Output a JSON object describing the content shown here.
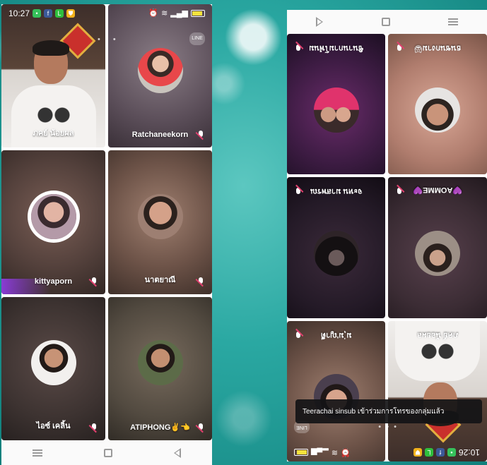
{
  "left_phone": {
    "status_bar": {
      "time": "10:27"
    },
    "tiles": [
      {
        "name": "ภคย์ น้อยผล"
      },
      {
        "name": "Ratchaneekorn"
      },
      {
        "name": "kittyaporn"
      },
      {
        "name": "นาตยาณี"
      },
      {
        "name": "ไอซ์ เคลิ้น"
      },
      {
        "name": "ATIPHONG✌️👈"
      }
    ],
    "line_badge": "LINE",
    "more_dots": "• • •"
  },
  "right_phone": {
    "status_bar": {
      "time": "10:26"
    },
    "tiles": [
      {
        "name": "ภคย์ น้อยผล"
      },
      {
        "name": "ม ุ่ม'ญาตี"
      },
      {
        "name": "💜AOMME💜"
      },
      {
        "name": "จะหน มาสพรณ"
      },
      {
        "name": "ธนชนกงาม😸"
      },
      {
        "name": "ชินานกามโฟ่นม"
      }
    ],
    "line_badge": "LINE",
    "more_dots": "• • •",
    "toast": "Teerachai sinsub เข้าร่วมการโทรของกลุ่มแล้ว"
  },
  "colors": {
    "background_teal": "#2aa8a2",
    "toast_bg": "#141416",
    "muted_mic": "#e0406e",
    "navbar_bg": "#fafafa"
  },
  "icons": {
    "status_left": [
      "messenger-icon",
      "facebook-icon",
      "line-icon",
      "shield-icon"
    ],
    "status_right": [
      "alarm-icon",
      "wifi-icon",
      "signal-icon",
      "battery-icon"
    ],
    "navbar": [
      "menu-icon",
      "home-icon",
      "back-icon"
    ]
  }
}
